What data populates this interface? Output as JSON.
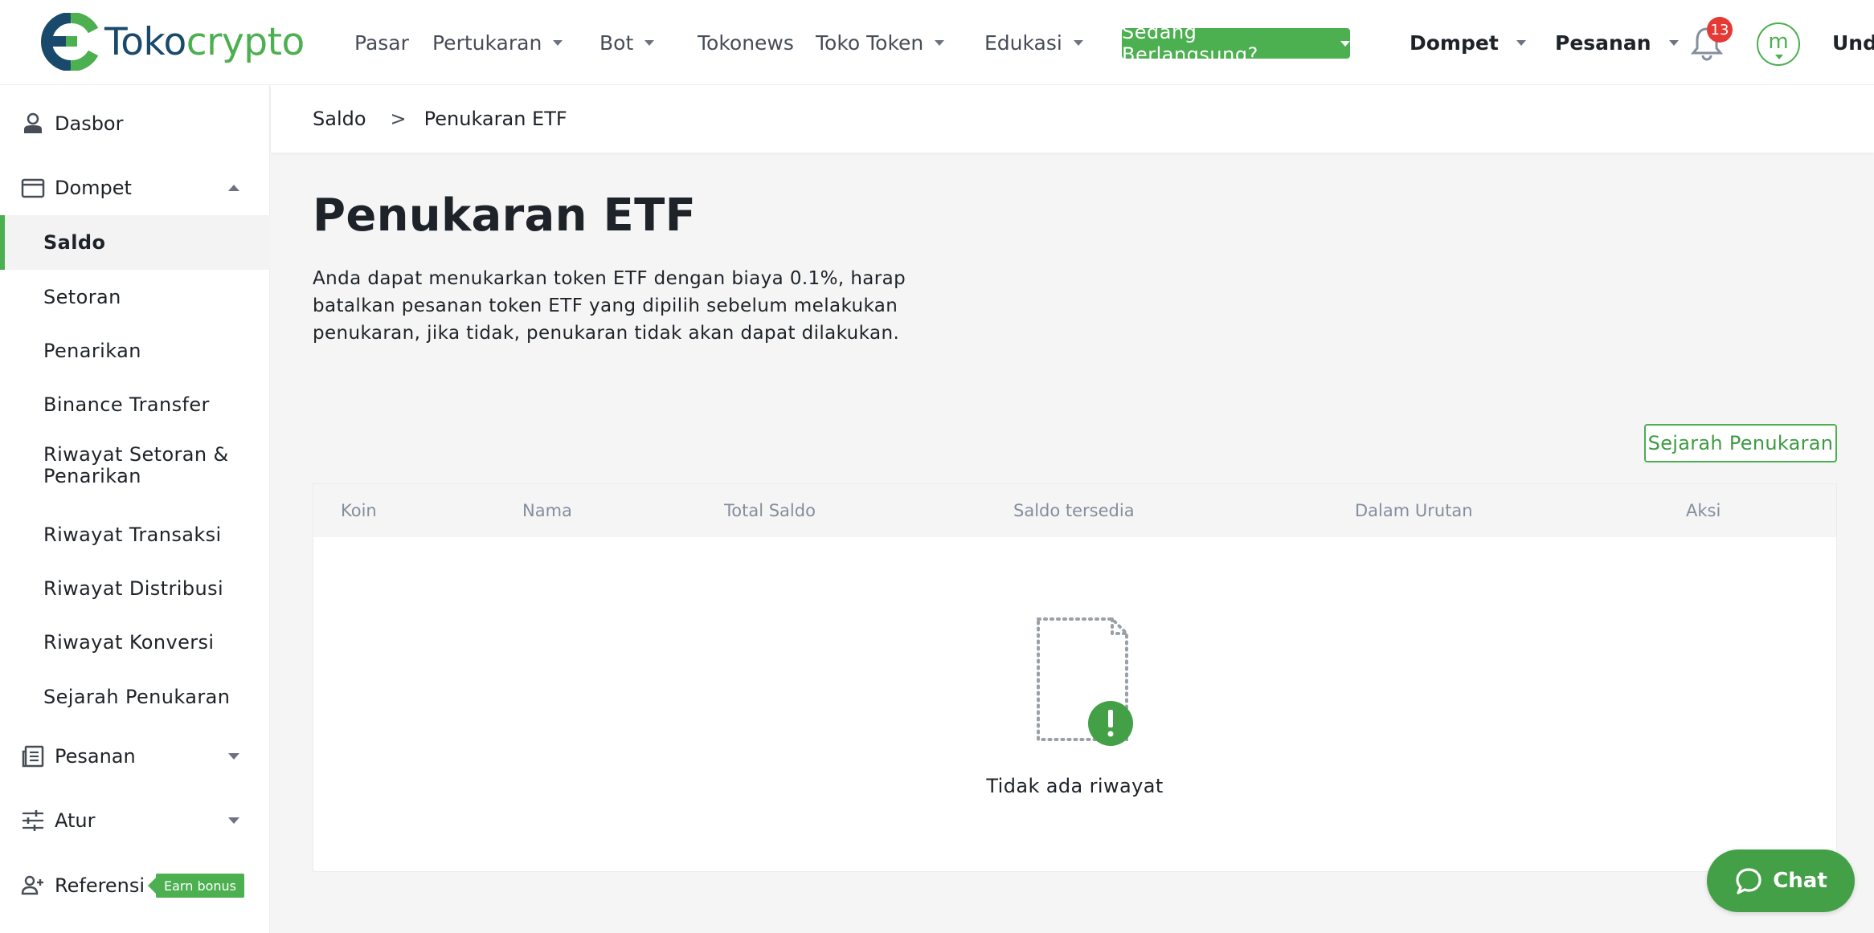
{
  "brand": {
    "logo_part1": "Toko",
    "logo_part2": "crypto",
    "color_dark": "#1a4a6b",
    "color_green": "#4caf50"
  },
  "nav": {
    "pasar": "Pasar",
    "pertukaran": "Pertukaran",
    "bot": "Bot",
    "tokonews": "Tokonews",
    "toko_token": "Toko Token",
    "edukasi": "Edukasi",
    "live": "Sedang Berlangsung?",
    "dompet": "Dompet",
    "pesanan": "Pesanan",
    "notif_count": "13",
    "avatar_letter": "m",
    "download": "Undu"
  },
  "sidebar": {
    "dasbor": "Dasbor",
    "dompet": "Dompet",
    "sub_items": [
      "Saldo",
      "Setoran",
      "Penarikan",
      "Binance Transfer",
      "Riwayat Setoran &",
      "Penarikan",
      "Riwayat Transaksi",
      "Riwayat Distribusi",
      "Riwayat Konversi",
      "Sejarah Penukaran"
    ],
    "pesanan": "Pesanan",
    "atur": "Atur",
    "referensi": "Referensi",
    "earn_bonus": "Earn bonus"
  },
  "breadcrumb": {
    "parent": "Saldo",
    "separator": ">",
    "current": "Penukaran ETF"
  },
  "main": {
    "title": "Penukaran ETF",
    "description": "Anda dapat menukarkan token ETF dengan biaya 0.1%, harap batalkan pesanan token ETF yang dipilih sebelum melakukan penukaran, jika tidak, penukaran tidak akan dapat dilakukan.",
    "history_button": "Sejarah Penukaran"
  },
  "table": {
    "columns": [
      "Koin",
      "Nama",
      "Total Saldo",
      "Saldo tersedia",
      "Dalam Urutan",
      "Aksi"
    ],
    "rows": [],
    "empty_text": "Tidak ada riwayat"
  },
  "chat": {
    "label": "Chat"
  },
  "colors": {
    "accent": "#4caf50",
    "badge_red": "#e53935",
    "text_dark": "#1e2329",
    "muted": "#848e9c"
  }
}
